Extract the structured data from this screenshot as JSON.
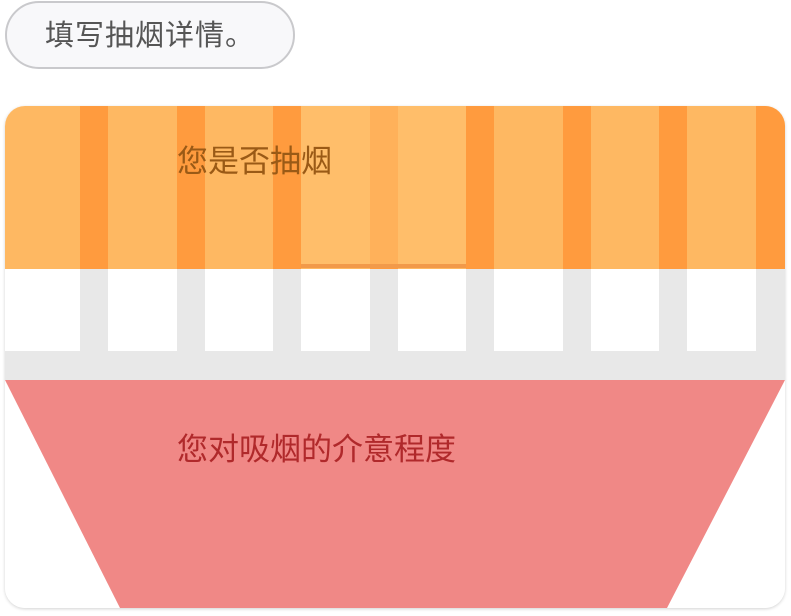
{
  "prompt": {
    "text": "填写抽烟详情。"
  },
  "card": {
    "questions": [
      {
        "label": "您是否抽烟"
      },
      {
        "label": "您对吸烟的介意程度"
      }
    ]
  },
  "colors": {
    "orange_band": "#feb862",
    "orange_stripe": "#ff9b3e",
    "gray_stripe": "#e8e8e8",
    "red_trapezoid": "#f08886",
    "pill_border": "#c9c9cc",
    "pill_background": "#f8f8fa"
  }
}
